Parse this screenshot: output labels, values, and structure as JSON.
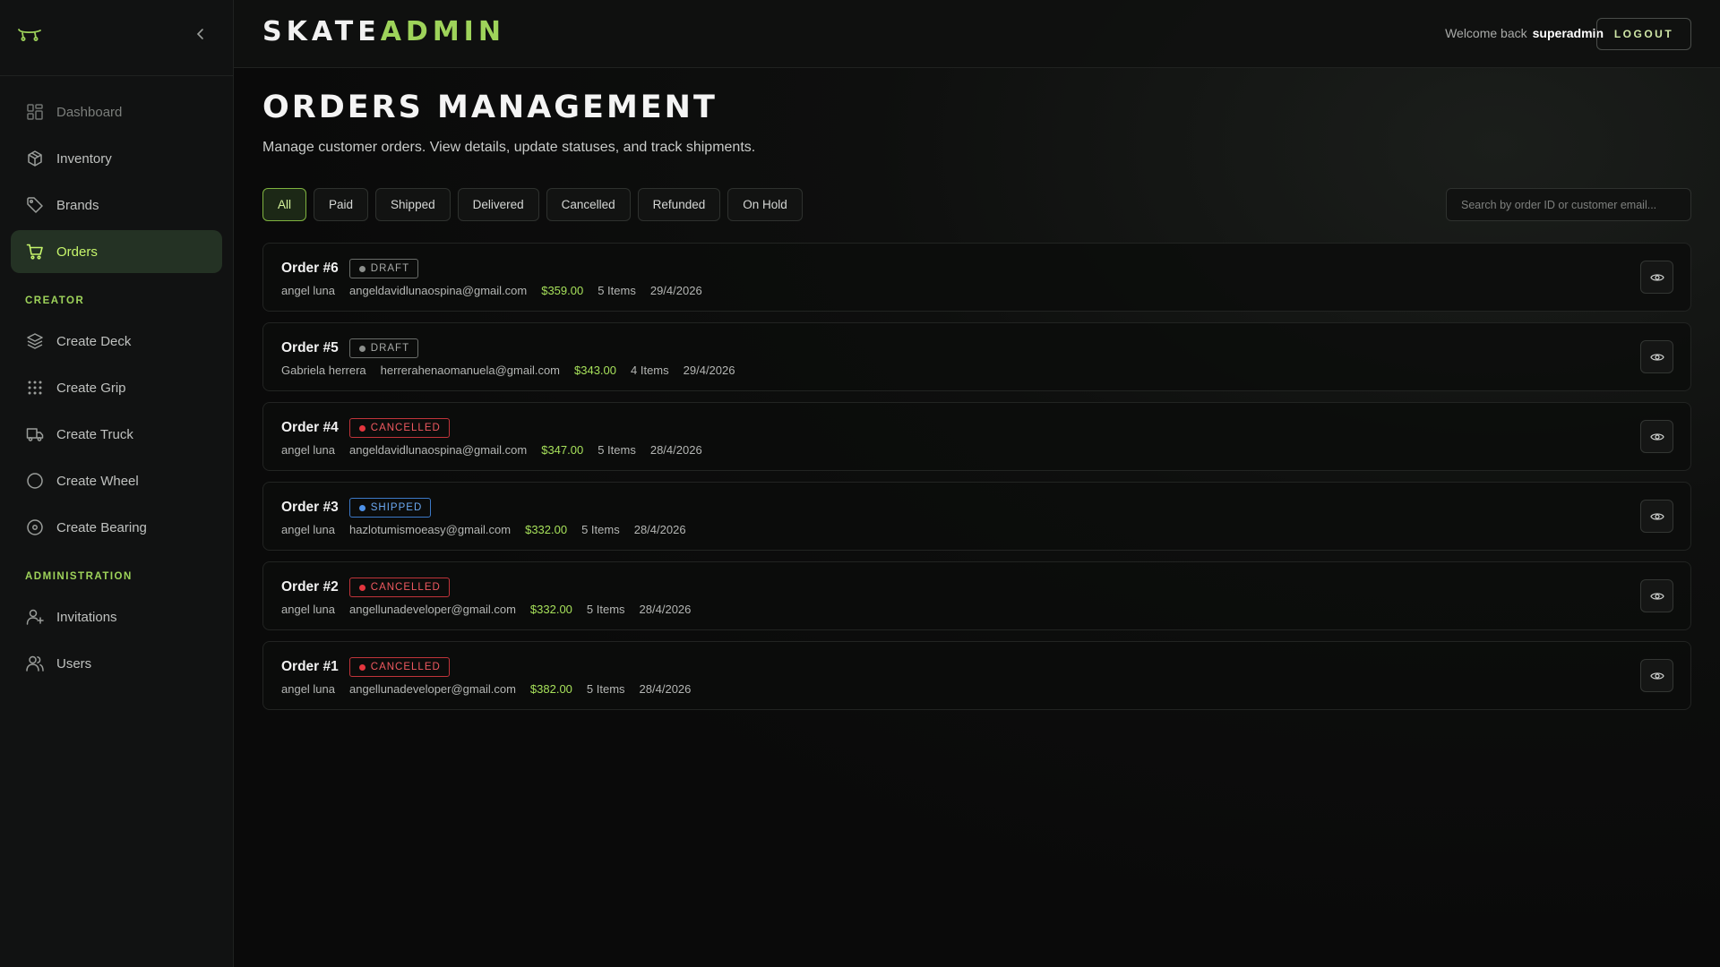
{
  "brand": {
    "part1": "SKATE",
    "part2": "ADMIN"
  },
  "header": {
    "welcome_label": "Welcome back",
    "username": "superadmin",
    "logout_label": "LOGOUT"
  },
  "sidebar": {
    "items": [
      {
        "label": "Dashboard",
        "icon": "grid-icon"
      },
      {
        "label": "Inventory",
        "icon": "box-icon"
      },
      {
        "label": "Brands",
        "icon": "tag-icon"
      },
      {
        "label": "Orders",
        "icon": "cart-icon"
      }
    ],
    "creator_label": "CREATOR",
    "creator_items": [
      {
        "label": "Create Deck",
        "icon": "layers-icon"
      },
      {
        "label": "Create Grip",
        "icon": "dots-grid-icon"
      },
      {
        "label": "Create Truck",
        "icon": "truck-icon"
      },
      {
        "label": "Create Wheel",
        "icon": "circle-icon"
      },
      {
        "label": "Create Bearing",
        "icon": "disc-icon"
      }
    ],
    "admin_label": "ADMINISTRATION",
    "admin_items": [
      {
        "label": "Invitations",
        "icon": "user-plus-icon"
      },
      {
        "label": "Users",
        "icon": "users-icon"
      }
    ]
  },
  "page": {
    "title": "ORDERS MANAGEMENT",
    "subtitle": "Manage customer orders. View details, update statuses, and track shipments."
  },
  "filters": [
    "All",
    "Paid",
    "Shipped",
    "Delivered",
    "Cancelled",
    "Refunded",
    "On Hold"
  ],
  "search": {
    "placeholder": "Search by order ID or customer email..."
  },
  "orders": [
    {
      "id": "Order #6",
      "status": "DRAFT",
      "customer": "angel luna",
      "email": "angeldavidlunaospina@gmail.com",
      "total": "$359.00",
      "items": "5 Items",
      "date": "29/4/2026"
    },
    {
      "id": "Order #5",
      "status": "DRAFT",
      "customer": "Gabriela herrera",
      "email": "herrerahenaomanuela@gmail.com",
      "total": "$343.00",
      "items": "4 Items",
      "date": "29/4/2026"
    },
    {
      "id": "Order #4",
      "status": "CANCELLED",
      "customer": "angel luna",
      "email": "angeldavidlunaospina@gmail.com",
      "total": "$347.00",
      "items": "5 Items",
      "date": "28/4/2026"
    },
    {
      "id": "Order #3",
      "status": "SHIPPED",
      "customer": "angel luna",
      "email": "hazlotumismoeasy@gmail.com",
      "total": "$332.00",
      "items": "5 Items",
      "date": "28/4/2026"
    },
    {
      "id": "Order #2",
      "status": "CANCELLED",
      "customer": "angel luna",
      "email": "angellunadeveloper@gmail.com",
      "total": "$332.00",
      "items": "5 Items",
      "date": "28/4/2026"
    },
    {
      "id": "Order #1",
      "status": "CANCELLED",
      "customer": "angel luna",
      "email": "angellunadeveloper@gmail.com",
      "total": "$382.00",
      "items": "5 Items",
      "date": "28/4/2026"
    }
  ],
  "colors": {
    "accent": "#9ed35a",
    "cancelled": "#e3363e",
    "shipped": "#4e92e8",
    "draft": "#8b8e8b"
  }
}
